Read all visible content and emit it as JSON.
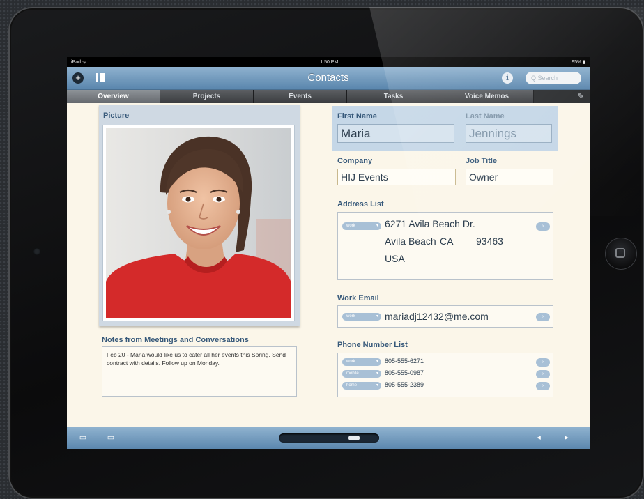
{
  "status_bar": {
    "carrier": "iPad ᯤ",
    "time": "1:50 PM",
    "battery": "95% ▮"
  },
  "nav": {
    "title": "Contacts",
    "add_icon": "+",
    "info_icon": "i",
    "search_placeholder": "Q Search"
  },
  "tabs": [
    {
      "label": "Overview",
      "active": true
    },
    {
      "label": "Projects",
      "active": false
    },
    {
      "label": "Events",
      "active": false
    },
    {
      "label": "Tasks",
      "active": false
    },
    {
      "label": "Voice Memos",
      "active": false
    }
  ],
  "picture": {
    "label": "Picture"
  },
  "notes": {
    "label": "Notes from Meetings and Conversations",
    "text": "Feb 20 - Maria would like us to cater all her events this Spring. Send contract with details. Follow up on Monday."
  },
  "contact": {
    "first_name_label": "First Name",
    "first_name": "Maria",
    "last_name_label": "Last Name",
    "last_name": "Jennings",
    "company_label": "Company",
    "company": "HIJ Events",
    "job_title_label": "Job Title",
    "job_title": "Owner"
  },
  "address": {
    "label": "Address List",
    "type": "work",
    "street": "6271 Avila Beach Dr.",
    "city": "Avila Beach",
    "state": "CA",
    "zip": "93463",
    "country": "USA"
  },
  "work_email": {
    "label": "Work Email",
    "type": "work",
    "value": "mariadj12432@me.com"
  },
  "phones": {
    "label": "Phone Number List",
    "items": [
      {
        "type": "work",
        "number": "805-555-6271"
      },
      {
        "type": "mobile",
        "number": "805-555-0987"
      },
      {
        "type": "home",
        "number": "805-555-2389"
      }
    ]
  },
  "colors": {
    "nav_blue": "#5a86ad",
    "label_blue": "#37597a",
    "paper": "#fbf6e9"
  },
  "icons": {
    "add": "add-icon",
    "grid": "grid-icon",
    "info": "info-icon",
    "edit": "pencil-icon",
    "bottom_left_1": "compose-icon",
    "bottom_left_2": "message-icon",
    "prev": "prev-arrow-icon",
    "next": "next-arrow-icon"
  }
}
